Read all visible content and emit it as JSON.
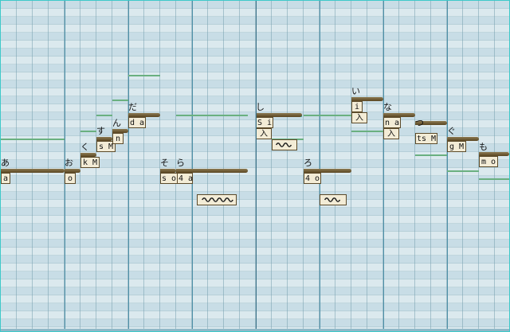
{
  "editor": {
    "notes": [
      {
        "lyric": "あ",
        "phoneme": "a"
      },
      {
        "lyric": "お",
        "phoneme": "o"
      },
      {
        "lyric": "く",
        "phoneme": "k M"
      },
      {
        "lyric": "す",
        "phoneme": "s M"
      },
      {
        "lyric": "ん",
        "phoneme": "n"
      },
      {
        "lyric": "だ",
        "phoneme": "d a"
      },
      {
        "lyric": "そ",
        "phoneme": "s o"
      },
      {
        "lyric": "ら",
        "phoneme": "4 a"
      },
      {
        "lyric": "し",
        "phoneme": "S i",
        "breath": "入"
      },
      {
        "lyric": "ろ",
        "phoneme": "4 o"
      },
      {
        "lyric": "い",
        "phoneme": "i",
        "breath": "入"
      },
      {
        "lyric": "な",
        "phoneme": "n a",
        "breath": "入"
      },
      {
        "lyric": "つ",
        "phoneme": "ts M"
      },
      {
        "lyric": "ぐ",
        "phoneme": "g M"
      },
      {
        "lyric": "も",
        "phoneme": "m o"
      }
    ],
    "vibrato_icon": "vibrato-wave-icon",
    "colors": {
      "lane_dark": "#c8dde6",
      "lane_light": "#dbe9ee",
      "note_bar": "#6b5530",
      "pitch_line": "#6ab080",
      "label_bg": "#f3ecd6"
    }
  }
}
